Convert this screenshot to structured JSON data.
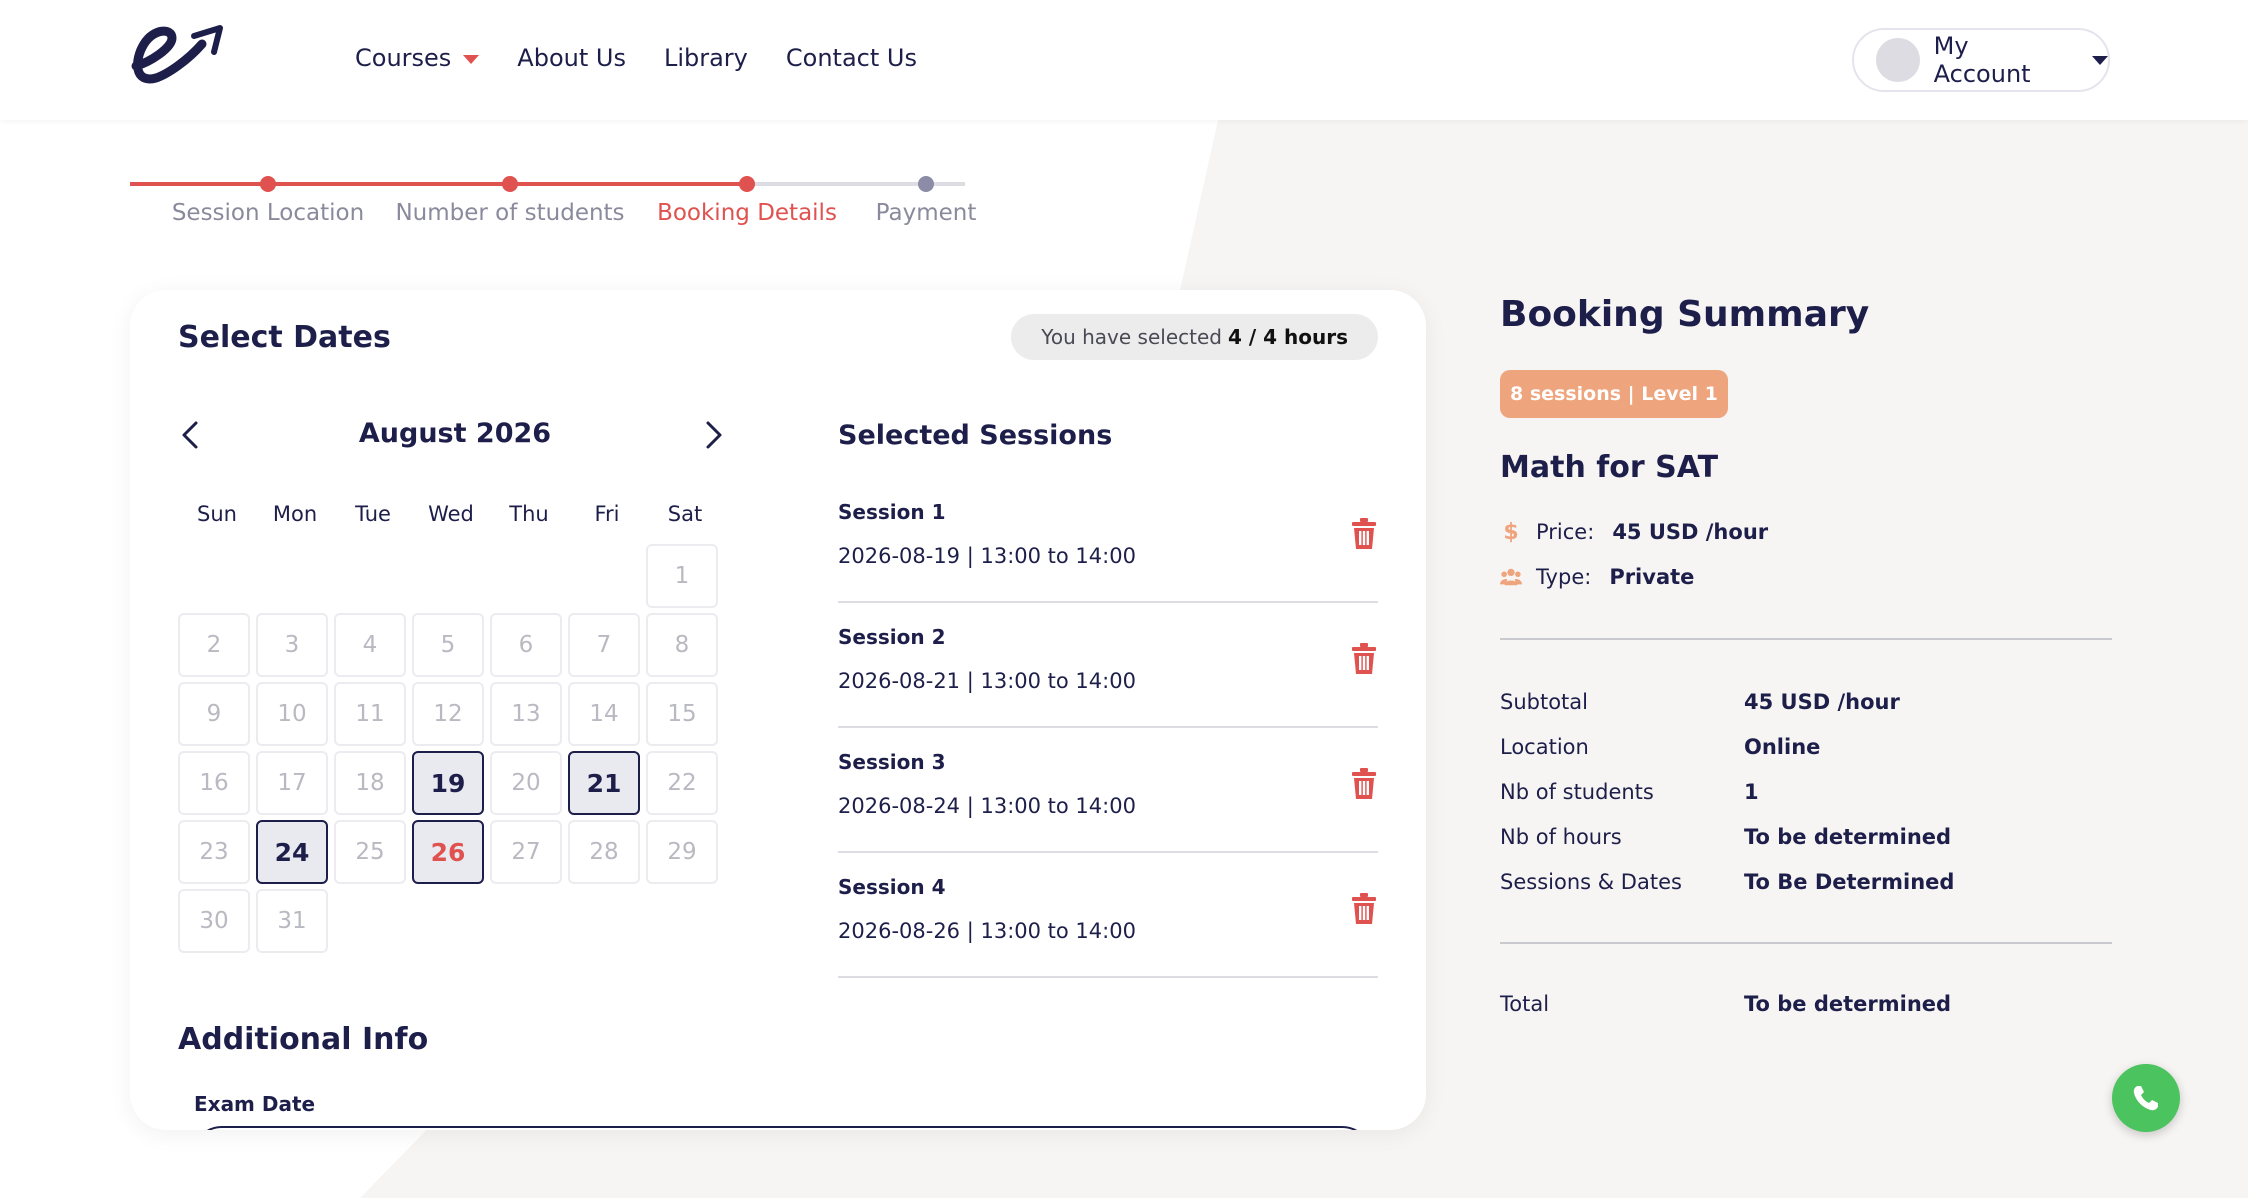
{
  "nav": {
    "items": [
      {
        "label": "Courses",
        "has_dropdown": true
      },
      {
        "label": "About Us"
      },
      {
        "label": "Library"
      },
      {
        "label": "Contact Us"
      }
    ],
    "account_label": "My Account"
  },
  "stepper": {
    "steps": [
      {
        "label": "Session Location",
        "state": "done"
      },
      {
        "label": "Number of students",
        "state": "done"
      },
      {
        "label": "Booking Details",
        "state": "active"
      },
      {
        "label": "Payment",
        "state": "pending"
      }
    ]
  },
  "dates": {
    "title": "Select Dates",
    "selected_prefix": "You have selected",
    "selected_value": "4 / 4 hours",
    "month_label": "August 2026",
    "weekdays": [
      "Sun",
      "Mon",
      "Tue",
      "Wed",
      "Thu",
      "Fri",
      "Sat"
    ],
    "days": [
      "1",
      "2",
      "3",
      "4",
      "5",
      "6",
      "7",
      "8",
      "9",
      "10",
      "11",
      "12",
      "13",
      "14",
      "15",
      "16",
      "17",
      "18",
      "19",
      "20",
      "21",
      "22",
      "23",
      "24",
      "25",
      "26",
      "27",
      "28",
      "29",
      "30",
      "31"
    ],
    "selected_days": [
      "19",
      "21",
      "24",
      "26"
    ],
    "highlight_day": "26"
  },
  "sessions": {
    "title": "Selected Sessions",
    "items": [
      {
        "name": "Session 1",
        "time": "2026-08-19 | 13:00 to 14:00"
      },
      {
        "name": "Session 2",
        "time": "2026-08-21 | 13:00 to 14:00"
      },
      {
        "name": "Session 3",
        "time": "2026-08-24 | 13:00 to 14:00"
      },
      {
        "name": "Session 4",
        "time": "2026-08-26 | 13:00 to 14:00"
      }
    ]
  },
  "additional": {
    "title": "Additional Info",
    "exam_label": "Exam Date"
  },
  "summary": {
    "title": "Booking Summary",
    "badge": "8 sessions | Level 1",
    "course": "Math for SAT",
    "price_label": "Price:",
    "price_value": "45 USD /hour",
    "type_label": "Type:",
    "type_value": "Private",
    "rows": [
      {
        "key": "Subtotal",
        "value": "45 USD /hour"
      },
      {
        "key": "Location",
        "value": "Online"
      },
      {
        "key": "Nb of students",
        "value": "1"
      },
      {
        "key": "Nb of hours",
        "value": "To be determined"
      },
      {
        "key": "Sessions & Dates",
        "value": "To Be Determined"
      }
    ],
    "total_key": "Total",
    "total_value": "To be determined"
  },
  "colors": {
    "accent": "#e0524f",
    "navy": "#1d1f4a",
    "badge": "#eea47c",
    "whatsapp": "#4bc35e"
  },
  "icons": {
    "price": "dollar-icon",
    "type": "users-icon",
    "delete": "trash-icon",
    "chat": "whatsapp-icon"
  }
}
